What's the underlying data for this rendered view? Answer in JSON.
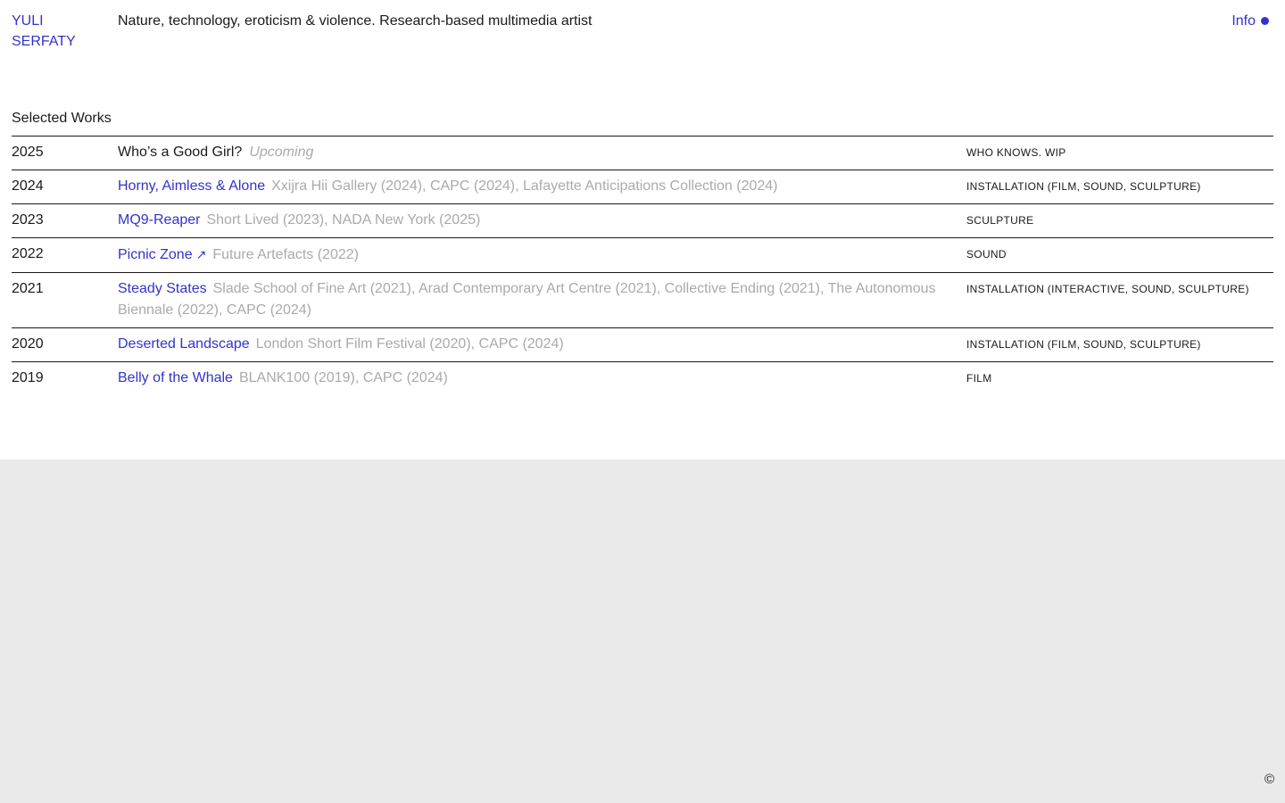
{
  "header": {
    "name_line1": "YULI",
    "name_line2": "SERFATY",
    "tagline": "Nature, technology, eroticism & violence. Research-based multimedia artist",
    "info_label": "Info"
  },
  "section_title": "Selected Works",
  "works": [
    {
      "year": "2025",
      "title": "Who’s a Good Girl?",
      "linked": false,
      "arrow": false,
      "status": "Upcoming",
      "shows": "",
      "category": "WHO KNOWS. WIP"
    },
    {
      "year": "2024",
      "title": "Horny, Aimless & Alone",
      "linked": true,
      "arrow": false,
      "status": "",
      "shows": "Xxijra Hii Gallery (2024), CAPC (2024), Lafayette Anticipations Collection (2024)",
      "category": "INSTALLATION (FILM, SOUND, SCULPTURE)"
    },
    {
      "year": "2023",
      "title": "MQ9-Reaper",
      "linked": true,
      "arrow": false,
      "status": "",
      "shows": "Short Lived (2023), NADA New York (2025)",
      "category": "SCULPTURE"
    },
    {
      "year": "2022",
      "title": "Picnic Zone",
      "linked": true,
      "arrow": true,
      "status": "",
      "shows": "Future Artefacts (2022)",
      "category": "SOUND"
    },
    {
      "year": "2021",
      "title": "Steady States",
      "linked": true,
      "arrow": false,
      "status": "",
      "shows": "Slade School of Fine Art (2021), Arad Contemporary Art Centre (2021), Collective Ending (2021), The Autonomous Biennale (2022), CAPC (2024)",
      "category": "INSTALLATION (INTERACTIVE, SOUND, SCULPTURE)"
    },
    {
      "year": "2020",
      "title": "Deserted Landscape",
      "linked": true,
      "arrow": false,
      "status": "",
      "shows": "London Short Film Festival (2020), CAPC (2024)",
      "category": "INSTALLATION (FILM, SOUND, SCULPTURE)"
    },
    {
      "year": "2019",
      "title": "Belly of the Whale",
      "linked": true,
      "arrow": false,
      "status": "",
      "shows": "BLANK100 (2019), CAPC (2024)",
      "category": "FILM"
    }
  ],
  "footer": {
    "copyright_symbol": "©"
  },
  "colors": {
    "accent": "#3333cc",
    "text": "#1a1a1a",
    "muted": "#aaaaaa",
    "footer_bg": "#eaeaea"
  }
}
